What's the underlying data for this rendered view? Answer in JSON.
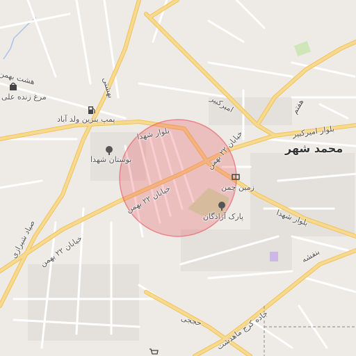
{
  "map": {
    "city_label": "محمد شهر",
    "streets": {
      "boulevard_shohada_left": "بلوار شهدا",
      "boulevard_shohada_right": "بلوار شهدا",
      "khiyaban_22_bahman_center": "خیابان ۲۲ بهمن",
      "khiyaban_22_bahman_upper": "خیابان ۲۲ بهمن",
      "khiyaban_22_bahman_left": "خیابان ۲۲ بهمن",
      "boulevard_amir_kabir": "بلوار امیرکبیر",
      "amir_kabir_diag": "امیرکبیر",
      "sayad_shirazi": "صیاد شیرازی",
      "hasht_bahman": "هشت بهمن",
      "hojjati": "حججی",
      "banafsheh": "بنفشه",
      "jadde_mahdasht": "جاده کرج ماهدشت",
      "beheshti": "بهشتی",
      "haftom": "هفتم"
    },
    "pois": {
      "morgh_zendeh": "مرغ زنده علی",
      "pomp_benzin": "پمپ بنزین ولد آباد",
      "bustan_shohada": "بوستان شهدا",
      "zamin_chaman": "زمین چمن",
      "park_azadegan": "پارک آزادگان"
    },
    "highlight_circle_color": "#e8505b",
    "road_major_color": "#f7d27a",
    "road_minor_color": "#ffffff",
    "park_color": "#cfe6b8"
  }
}
